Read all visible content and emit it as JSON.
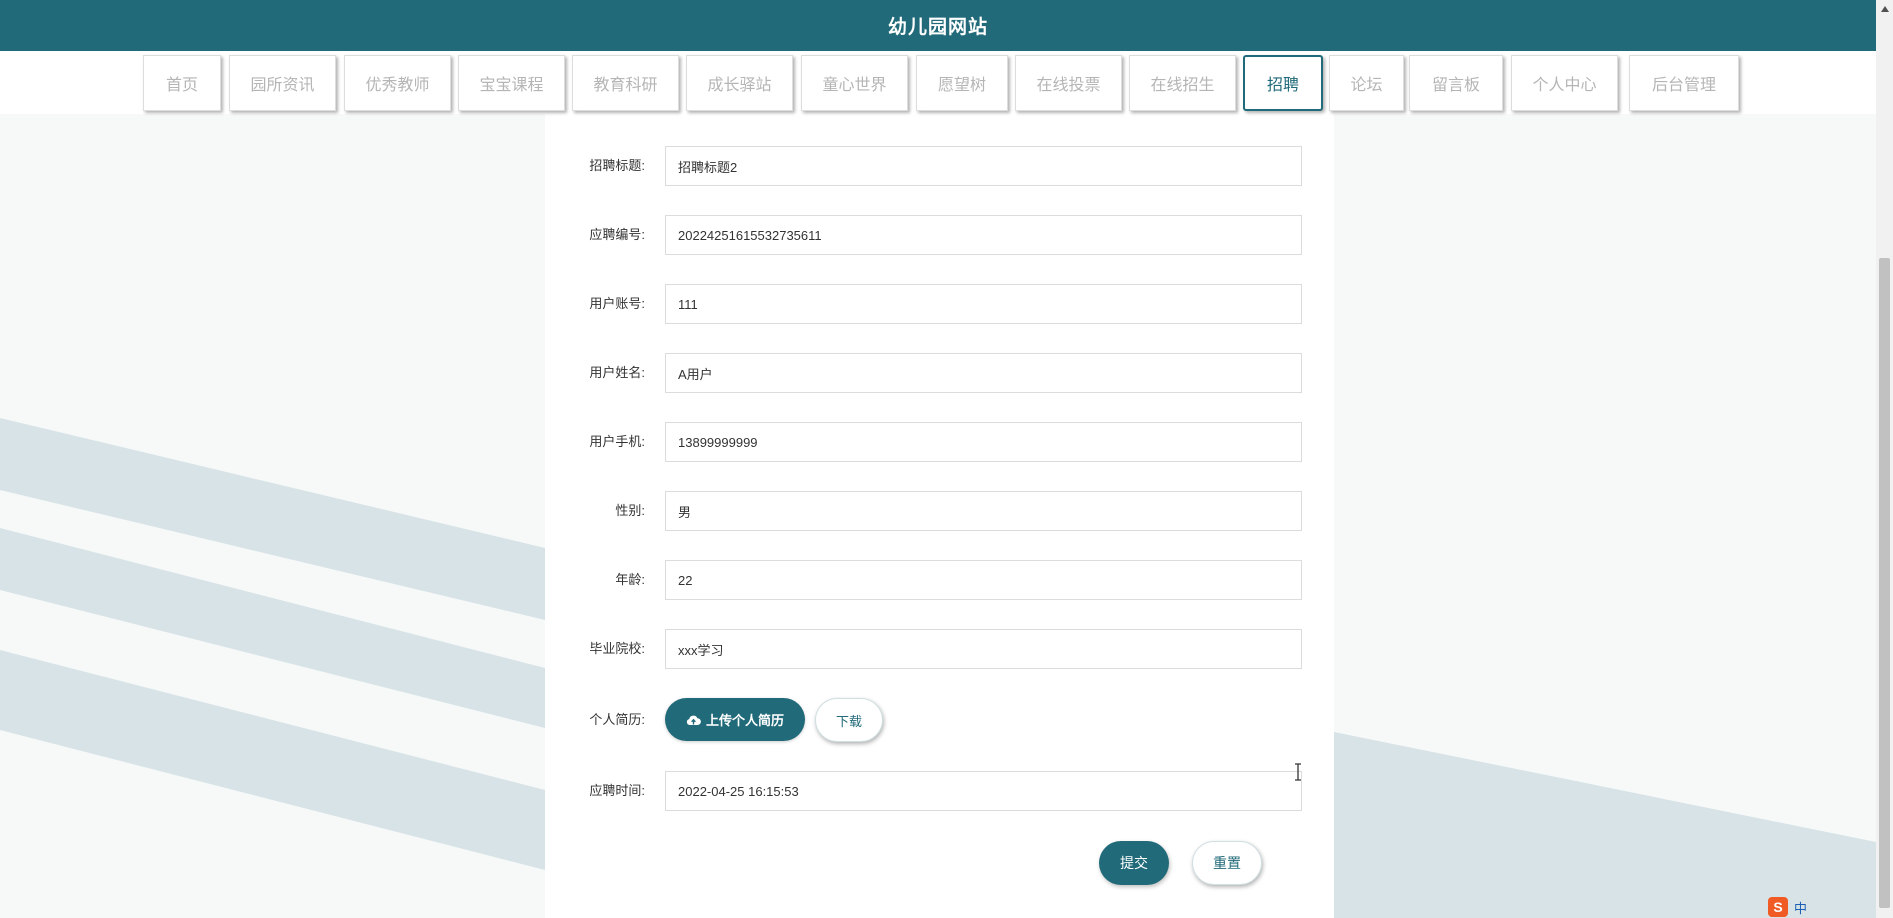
{
  "app": {
    "title": "幼儿园网站"
  },
  "nav": {
    "items": [
      {
        "label": "首页"
      },
      {
        "label": "园所资讯"
      },
      {
        "label": "优秀教师"
      },
      {
        "label": "宝宝课程"
      },
      {
        "label": "教育科研"
      },
      {
        "label": "成长驿站"
      },
      {
        "label": "童心世界"
      },
      {
        "label": "愿望树"
      },
      {
        "label": "在线投票"
      },
      {
        "label": "在线招生"
      },
      {
        "label": "招聘"
      },
      {
        "label": "论坛"
      },
      {
        "label": "留言板"
      },
      {
        "label": "个人中心"
      },
      {
        "label": "后台管理"
      }
    ],
    "active": "招聘"
  },
  "form": {
    "title_label": "招聘标题:",
    "title_value": "招聘标题2",
    "number_label": "应聘编号:",
    "number_value": "20224251615532735611",
    "account_label": "用户账号:",
    "account_value": "111",
    "name_label": "用户姓名:",
    "name_value": "A用户",
    "phone_label": "用户手机:",
    "phone_value": "13899999999",
    "gender_label": "性别:",
    "gender_value": "男",
    "age_label": "年龄:",
    "age_value": "22",
    "school_label": "毕业院校:",
    "school_value": "xxx学习",
    "resume_label": "个人简历:",
    "upload_label": "上传个人简历",
    "download_label": "下载",
    "time_label": "应聘时间:",
    "time_value": "2022-04-25 16:15:53",
    "submit_label": "提交",
    "reset_label": "重置"
  },
  "ime": {
    "lang": "中"
  },
  "colors": {
    "primary": "#216a79",
    "stripe": "#d7e3e6",
    "background": "#f7f9f9"
  },
  "icons": [
    "cloud-upload-icon",
    "text-cursor-icon",
    "scroll-up-icon",
    "sogou-ime-icon"
  ]
}
